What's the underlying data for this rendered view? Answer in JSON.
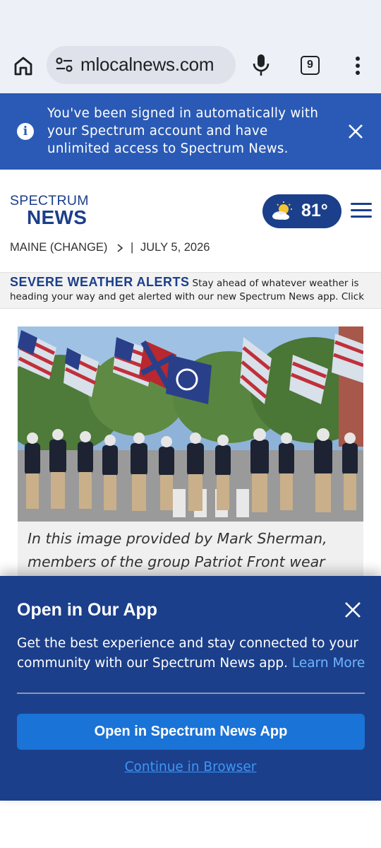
{
  "browser": {
    "url": "mlocalnews.com",
    "tab_count": "9",
    "icons": [
      "home-icon",
      "site-settings-icon",
      "microphone-icon",
      "tab-switcher-icon",
      "more-options-icon"
    ]
  },
  "signin_banner": {
    "message": "You've been signed in automatically with your Spectrum account and have unlimited access to Spectrum News.",
    "icons": [
      "info-icon",
      "close-icon"
    ]
  },
  "header": {
    "logo_line1": "SPECTRUM",
    "logo_line2": "NEWS",
    "temperature": "81°",
    "weather_icon": "partly-cloudy-icon"
  },
  "location_bar": {
    "location": "MAINE (CHANGE)",
    "separator": "|",
    "date": "JULY 5, 2026"
  },
  "alerts": {
    "heading": "SEVERE WEATHER ALERTS",
    "text_line1": "Stay ahead of whatever weather is",
    "text_line2": "heading your way and get alerted with our new Spectrum News app. Click"
  },
  "article": {
    "caption": "In this image provided by Mark Sherman, members of the group Patriot Front wear"
  },
  "app_sheet": {
    "title": "Open in Our App",
    "body": "Get the best experience and stay connected to your community with our Spectrum News app.",
    "learn_more": "Learn More",
    "open_button": "Open in Spectrum News App",
    "continue_link": "Continue in Browser"
  },
  "colors": {
    "brand_blue": "#1b3f8b",
    "banner_blue": "#2a5ab5",
    "button_blue": "#1a73d6",
    "link_blue": "#3d97f5"
  }
}
